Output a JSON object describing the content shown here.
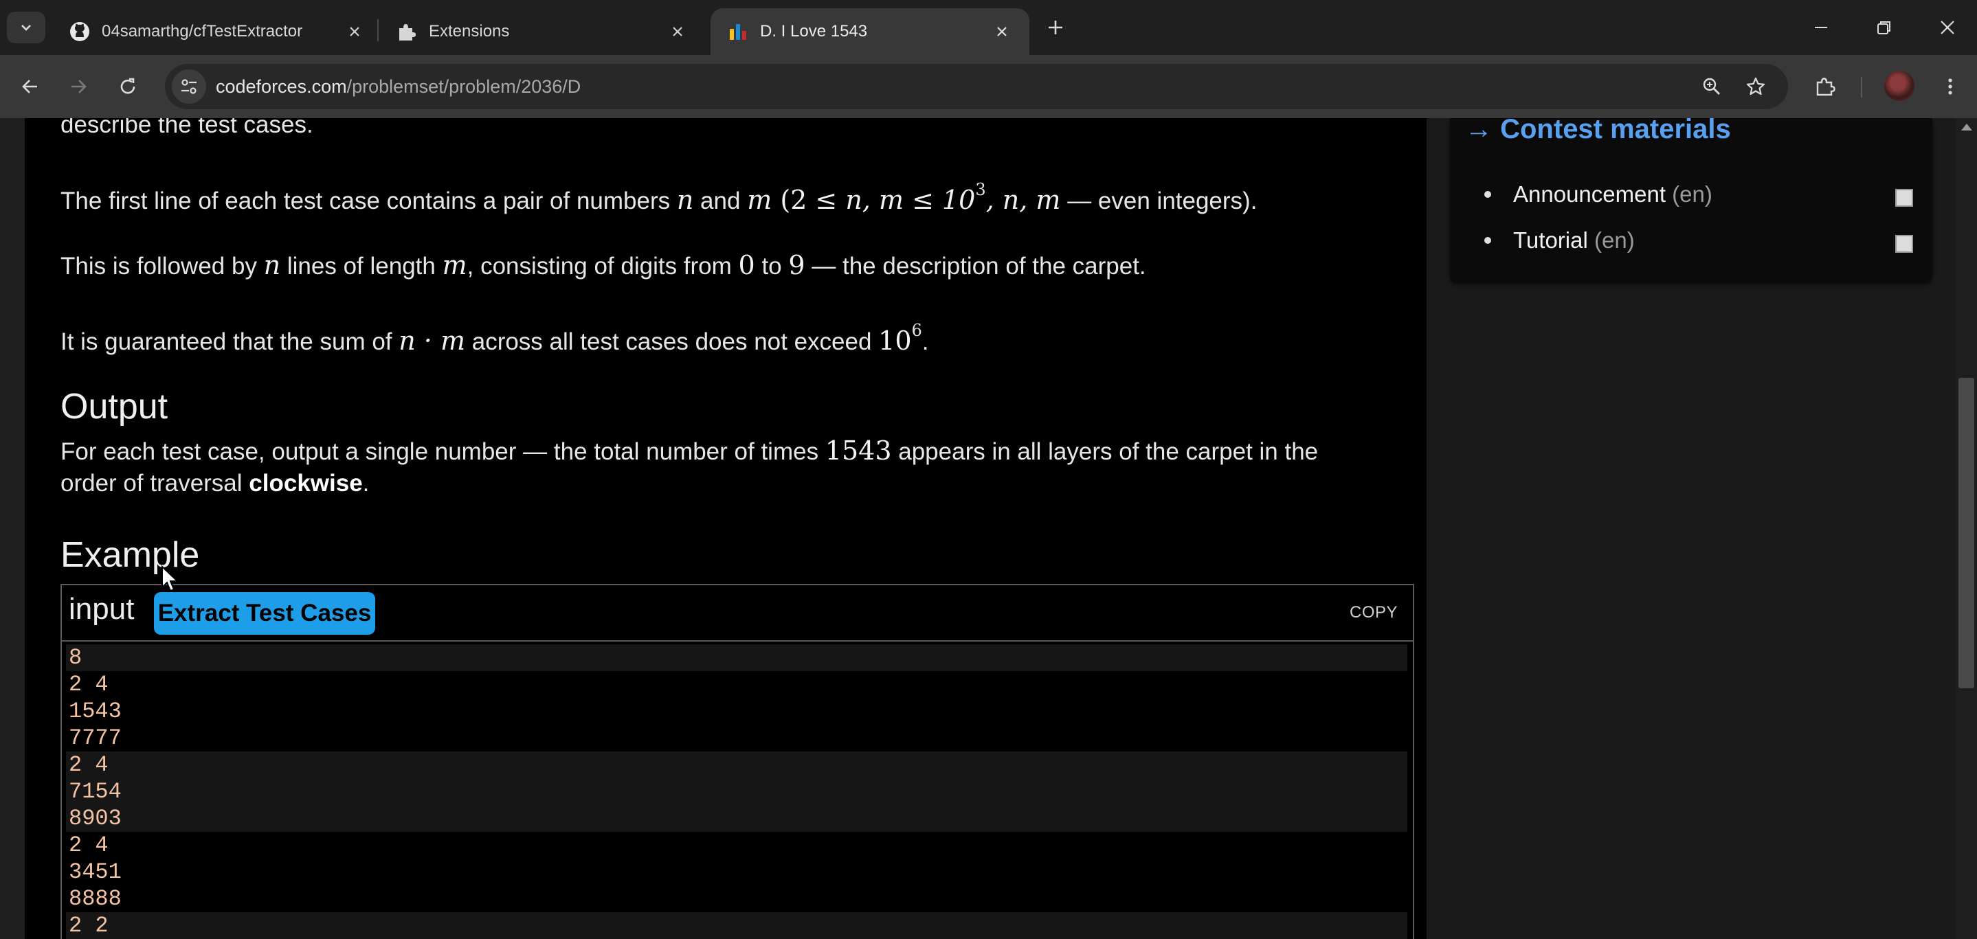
{
  "tabs": [
    {
      "title": "04samarthg/cfTestExtractor",
      "icon": "github-icon"
    },
    {
      "title": "Extensions",
      "icon": "puzzle-piece-icon"
    },
    {
      "title": "D. I Love 1543",
      "icon": "codeforces-icon",
      "active": true
    }
  ],
  "address_bar": {
    "domain": "codeforces.com",
    "path": "/problemset/problem/2036/D"
  },
  "statement": {
    "top_fragment": "describe the test cases.",
    "p1": {
      "a": "The first line of each test case contains a pair of numbers ",
      "n": "n",
      "and": " and ",
      "m": "m",
      "paren": " (2 ≤ ",
      "mid": "n, m ≤ 10",
      "sup": "3",
      "tail_math": ", n, m",
      "tail": " — even integers)."
    },
    "p2": {
      "a": "This is followed by ",
      "n": "n",
      "b": " lines of length ",
      "m": "m",
      "c": ", consisting of digits from ",
      "zero": "0",
      "to": " to ",
      "nine": "9",
      "d": " — the description of the carpet."
    },
    "p3": {
      "a": "It is guaranteed that the sum of ",
      "expr": "n · m",
      "b": " across all test cases does not exceed ",
      "base": "10",
      "sup": "6",
      "end": "."
    },
    "output_title": "Output",
    "output_line1": {
      "a": "For each test case, output a single number — the total number of times ",
      "num": "1543",
      "b": " appears in all layers of the carpet in the"
    },
    "output_line2": {
      "a": "order of traversal ",
      "bold": "clockwise",
      "b": "."
    },
    "example_title": "Example"
  },
  "sample": {
    "input_label": "input",
    "extract_button": "Extract Test Cases",
    "copy_label": "COPY",
    "lines": [
      "8",
      "2 4",
      "1543",
      "7777",
      "2 4",
      "7154",
      "8903",
      "2 4",
      "3451",
      "8888",
      "2 2"
    ]
  },
  "sidebar": {
    "contest_materials_title": "→ Contest materials",
    "items": [
      {
        "label": "Announcement",
        "lang": "(en)"
      },
      {
        "label": "Tutorial",
        "lang": "(en)"
      }
    ]
  }
}
